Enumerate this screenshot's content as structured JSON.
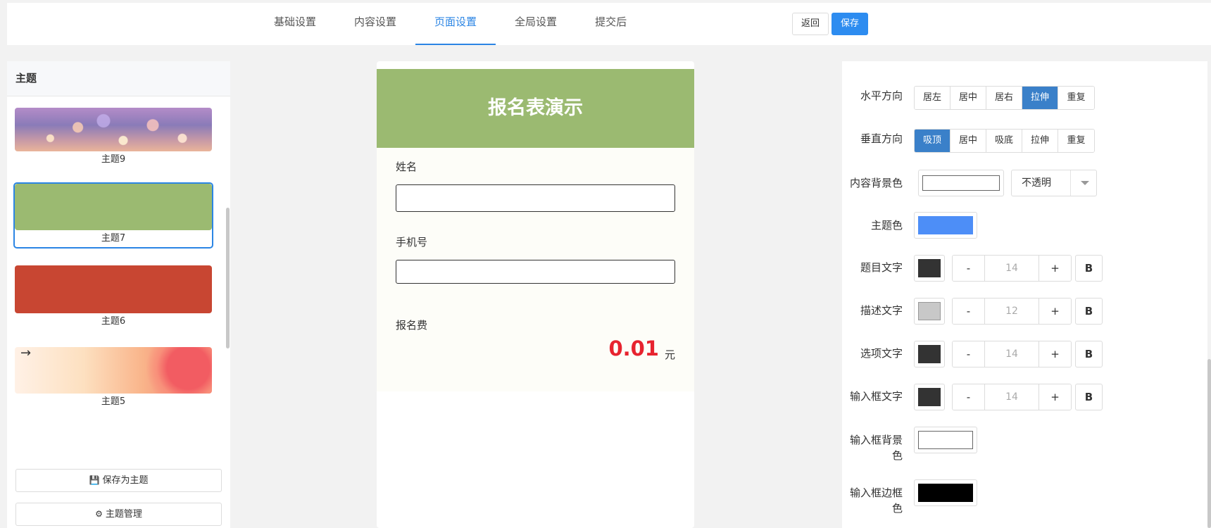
{
  "top_tabs": [
    {
      "label": "基础设置",
      "active": false
    },
    {
      "label": "内容设置",
      "active": false
    },
    {
      "label": "页面设置",
      "active": true
    },
    {
      "label": "全局设置",
      "active": false
    },
    {
      "label": "提交后",
      "active": false
    }
  ],
  "top_actions": {
    "back_label": "返回",
    "save_label": "保存"
  },
  "theme_panel": {
    "title": "主题",
    "themes": [
      {
        "name": "主题9",
        "style": "bokeh"
      },
      {
        "name": "主题7",
        "style": "solid",
        "color": "#9bba71",
        "selected": true
      },
      {
        "name": "主题6",
        "style": "solid",
        "color": "#c84632"
      },
      {
        "name": "主题5",
        "style": "gradient"
      }
    ],
    "save_as_theme_label": "保存为主题",
    "theme_manage_label": "主题管理"
  },
  "preview": {
    "banner_title": "报名表演示",
    "banner_color": "#9bba71",
    "field_name_label": "姓名",
    "field_phone_label": "手机号",
    "fee_label": "报名费",
    "fee_value": "0.01",
    "fee_unit": "元"
  },
  "settings": {
    "horizontal": {
      "label": "水平方向",
      "options": [
        "居左",
        "居中",
        "居右",
        "拉伸",
        "重复"
      ],
      "active_index": 3
    },
    "vertical": {
      "label": "垂直方向",
      "options": [
        "吸顶",
        "居中",
        "吸底",
        "拉伸",
        "重复"
      ],
      "active_index": 0
    },
    "content_bg": {
      "label": "内容背景色",
      "opacity_value": "不透明"
    },
    "theme_color": {
      "label": "主题色",
      "color": "#4d8ef7"
    },
    "title_text": {
      "label": "题目文字",
      "color": "#333333",
      "size": "14",
      "minus": "-",
      "plus": "+",
      "bold": "B"
    },
    "desc_text": {
      "label": "描述文字",
      "color": "#c8c8c8",
      "size": "12",
      "minus": "-",
      "plus": "+",
      "bold": "B"
    },
    "option_text": {
      "label": "选项文字",
      "color": "#333333",
      "size": "14",
      "minus": "-",
      "plus": "+",
      "bold": "B"
    },
    "input_text": {
      "label": "输入框文字",
      "color": "#333333",
      "size": "14",
      "minus": "-",
      "plus": "+",
      "bold": "B"
    },
    "input_bg": {
      "label": "输入框背景色",
      "color": "#ffffff"
    },
    "input_border": {
      "label": "输入框边框色",
      "color": "#000000"
    }
  }
}
